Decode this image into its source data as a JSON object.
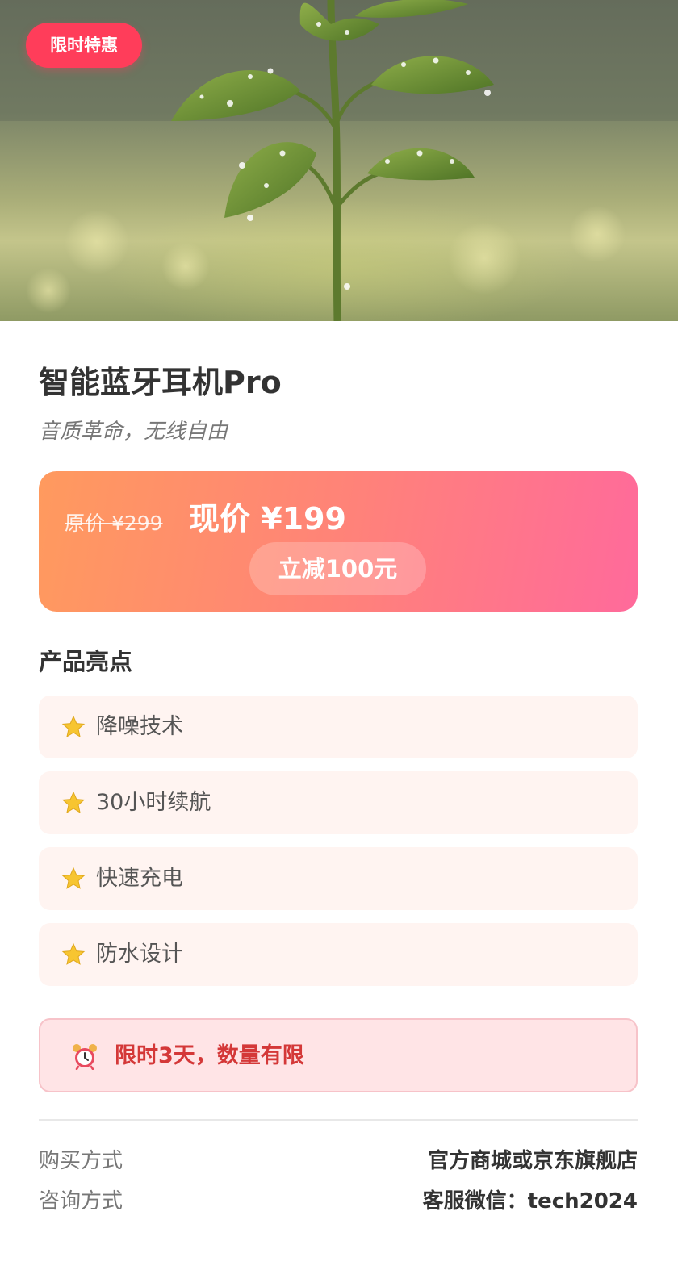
{
  "hero": {
    "image_description": "seedling-with-dew-drops",
    "promo_tag": "限时特惠"
  },
  "product": {
    "title": "智能蓝牙耳机Pro",
    "subtitle": "音质革命，无线自由"
  },
  "price": {
    "original": "原价 ¥299",
    "current": "现价 ¥199",
    "discount": "立减100元"
  },
  "highlights": {
    "title": "产品亮点",
    "items": [
      {
        "icon": "star-icon",
        "label": "降噪技术"
      },
      {
        "icon": "star-icon",
        "label": "30小时续航"
      },
      {
        "icon": "star-icon",
        "label": "快速充电"
      },
      {
        "icon": "star-icon",
        "label": "防水设计"
      }
    ]
  },
  "urgency": {
    "icon": "alarm-clock-icon",
    "text": "限时3天，数量有限"
  },
  "info": {
    "purchase_label": "购买方式",
    "purchase_value": "官方商城或京东旗舰店",
    "contact_label": "咨询方式",
    "contact_value": "客服微信：tech2024"
  },
  "colors": {
    "promo_tag": "#ff3d5a",
    "price_gradient_start": "#ff9a5e",
    "price_gradient_end": "#ff6a9b",
    "feature_bg": "#fff4f1",
    "urgency_bg": "#ffe4e6",
    "urgency_text": "#d43838"
  }
}
